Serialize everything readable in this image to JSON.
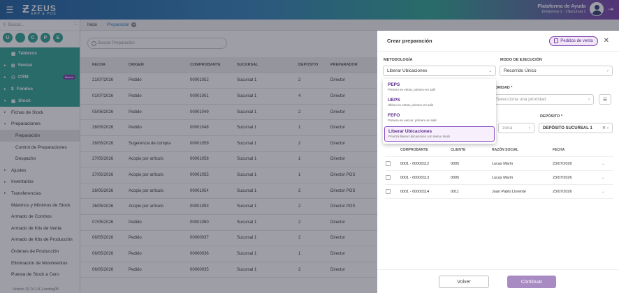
{
  "header": {
    "logo_name": "ZEUS",
    "logo_sub": "ERP & POS",
    "help_title": "Plataforma de Ayuda",
    "help_sub": "1Empresa 1 · 1Sucursal 1"
  },
  "sidebar": {
    "search_placeholder": "Buscar...",
    "circles": [
      "U",
      "",
      "C",
      "P",
      "E"
    ],
    "modules": [
      {
        "label": "Tableros",
        "caret": ""
      },
      {
        "label": "Ventas",
        "caret": "▸"
      },
      {
        "label": "CRM",
        "caret": "▸",
        "badge": "Nuevo"
      },
      {
        "label": "Fondos",
        "caret": "▸"
      },
      {
        "label": "Stock",
        "caret": "▾"
      }
    ],
    "items": [
      {
        "label": "Fichas de Stock",
        "caret": "▸",
        "sub": false
      },
      {
        "label": "Preparaciones",
        "caret": "▾",
        "sub": false
      },
      {
        "label": "Preparación",
        "caret": "",
        "sub": true,
        "selected": true
      },
      {
        "label": "Control de Preparaciones",
        "caret": "",
        "sub": true
      },
      {
        "label": "Despacho",
        "caret": "",
        "sub": true
      },
      {
        "label": "Ajustes",
        "caret": "▸",
        "sub": false
      },
      {
        "label": "Inventarios",
        "caret": "▸",
        "sub": false
      },
      {
        "label": "Transferencias",
        "caret": "▸",
        "sub": false
      },
      {
        "label": "Máximos y Mínimos de Stock",
        "caret": "",
        "sub": false
      },
      {
        "label": "Armado de Combos",
        "caret": "",
        "sub": false
      },
      {
        "label": "Armado de Kits de Venta",
        "caret": "",
        "sub": false
      },
      {
        "label": "Armado de Kits de Producción",
        "caret": "",
        "sub": false
      },
      {
        "label": "Órdenes de Producción",
        "caret": "",
        "sub": false
      },
      {
        "label": "Eliminación de Movimientos",
        "caret": "",
        "sub": false
      },
      {
        "label": "Puesta de Stock a Cero",
        "caret": "",
        "sub": false
      }
    ],
    "version": "Versión 10.74.1-8-1-testing08"
  },
  "tabs": [
    {
      "label": "Inicio"
    },
    {
      "label": "Preparación"
    }
  ],
  "main": {
    "search_placeholder": "Buscar Preparación",
    "columns": [
      "FECHA",
      "ORIGEN",
      "COMPROBANTE",
      "SUCURSAL",
      "DEPOSITO",
      "PREPARADOR"
    ],
    "rows": [
      [
        "21/07/2026",
        "Pedido",
        "00001052",
        "Sucursal 1",
        "2",
        "Director"
      ],
      [
        "01/07/2026",
        "Pedido",
        "00001051",
        "Sucursal 1",
        "4",
        "Director"
      ],
      [
        "05/06/2026",
        "Pedido",
        "00001049",
        "Sucursal 1",
        "2",
        "Director"
      ],
      [
        "28/05/2026",
        "Pedido",
        "00001048",
        "Sucursal 1",
        "1",
        "Director"
      ],
      [
        "28/05/2026",
        "Sugerencia de compra",
        "00001059",
        "Sucursal 1",
        "2",
        "Director"
      ],
      [
        "27/05/2026",
        "Acopio por artículo",
        "00001058",
        "Sucursal 1",
        "1",
        "Director"
      ],
      [
        "27/05/2026",
        "Acopio por artículo",
        "00001055",
        "Sucursal 1",
        "1",
        "Director POS"
      ],
      [
        "26/05/2026",
        "Acopio por artículo",
        "00001054",
        "Sucursal 1",
        "2",
        "Director POS"
      ],
      [
        "26/05/2026",
        "Acopio por artículo",
        "00001053",
        "Sucursal 1",
        "2",
        "Director POS"
      ],
      [
        "07/05/2026",
        "Pedido",
        "00001050",
        "Sucursal 1",
        "2",
        "Director"
      ],
      [
        "06/05/2026",
        "Pedido",
        "00000037",
        "Sucursal 1",
        "2",
        "Director"
      ],
      [
        "06/05/2026",
        "Pedido",
        "00000036",
        "Sucursal 1",
        "1",
        "Director"
      ],
      [
        "06/05/2026",
        "Pedido",
        "00000035",
        "Sucursal 1",
        "2",
        "Director"
      ]
    ]
  },
  "drawer": {
    "title": "Crear preparación",
    "pedidos_btn": "Pedidos de venta",
    "metodologia_label": "METODOLOGÍA",
    "metodologia_value": "Liberar Ubicaciones",
    "modo_label": "MODO DE EJECUCIÓN",
    "modo_value": "Recorrido Único",
    "prioridad_label": "ORIDAD *",
    "prioridad_placeholder": "Selecciona una prioridad",
    "zona_placeholder": "zona",
    "deposito_label": "DEPÓSITO *",
    "deposito_value": "DEPÓSITO SUCURSAL 1",
    "options": [
      {
        "name": "PEPS",
        "desc": "Primero en entrar, primero en salir"
      },
      {
        "name": "UEPS",
        "desc": "Último en entrar, primero en salir"
      },
      {
        "name": "FEFO",
        "desc": "Primero en vencer, primero en salir"
      },
      {
        "name": "Liberar Ubicaciones",
        "desc": "Prioriza liberar ubicaciones con menor stock"
      }
    ],
    "columns": [
      "COMPROBANTE",
      "CLIENTE",
      "RAZÓN SOCIAL",
      "FECHA"
    ],
    "rows": [
      [
        "0001 - 00000112",
        "0005",
        "Lucas Marín",
        "23/07/2026"
      ],
      [
        "0001 - 00000113",
        "0005",
        "Lucas Marín",
        "23/07/2026"
      ],
      [
        "0001 - 00000114",
        "0011",
        "Juan Pablo Llorente",
        "23/07/2026"
      ]
    ],
    "volver": "Volver",
    "continuar": "Continuar"
  },
  "colors": {
    "brand_teal": "#2aa38f",
    "brand_purple": "#7a3fa8",
    "brand_blue": "#2f7fb6"
  }
}
